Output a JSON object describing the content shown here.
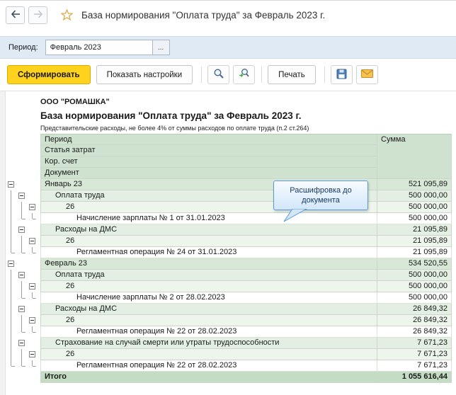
{
  "window": {
    "title": "База нормирования \"Оплата труда\" за Февраль 2023 г."
  },
  "period_bar": {
    "label": "Период:",
    "value": "Февраль 2023",
    "ellipsis": "..."
  },
  "toolbar": {
    "generate": "Сформировать",
    "settings": "Показать настройки",
    "print": "Печать"
  },
  "report": {
    "company": "ООО \"РОМАШКА\"",
    "title": "База нормирования \"Оплата труда\" за Февраль 2023 г.",
    "note": "Представительские расходы, не более 4% от суммы расходов по оплате труда (п.2 ст.264)",
    "header_rows": [
      "Период",
      "Статья затрат",
      "Кор. счет",
      "Документ"
    ],
    "sum_header": "Сумма",
    "rows": [
      {
        "label": "Январь 23",
        "value": "521 095,89",
        "level": 1,
        "expander": true
      },
      {
        "label": "Оплата труда",
        "value": "500 000,00",
        "level": 2,
        "expander": true
      },
      {
        "label": "26",
        "value": "500 000,00",
        "level": 3,
        "expander": true
      },
      {
        "label": "Начисление зарплаты № 1 от 31.01.2023",
        "value": "500 000,00",
        "level": 4,
        "expander": false
      },
      {
        "label": "Расходы на ДМС",
        "value": "21 095,89",
        "level": 2,
        "expander": true
      },
      {
        "label": "26",
        "value": "21 095,89",
        "level": 3,
        "expander": true
      },
      {
        "label": "Регламентная операция № 24 от 31.01.2023",
        "value": "21 095,89",
        "level": 4,
        "expander": false
      },
      {
        "label": "Февраль 23",
        "value": "534 520,55",
        "level": 1,
        "expander": true
      },
      {
        "label": "Оплата труда",
        "value": "500 000,00",
        "level": 2,
        "expander": true
      },
      {
        "label": "26",
        "value": "500 000,00",
        "level": 3,
        "expander": true
      },
      {
        "label": "Начисление зарплаты № 2 от 28.02.2023",
        "value": "500 000,00",
        "level": 4,
        "expander": false
      },
      {
        "label": "Расходы на ДМС",
        "value": "26 849,32",
        "level": 2,
        "expander": true
      },
      {
        "label": "26",
        "value": "26 849,32",
        "level": 3,
        "expander": true
      },
      {
        "label": "Регламентная операция № 22 от 28.02.2023",
        "value": "26 849,32",
        "level": 4,
        "expander": false
      },
      {
        "label": "Страхование на случай смерти или утраты трудоспособности",
        "value": "7 671,23",
        "level": 2,
        "expander": true
      },
      {
        "label": "26",
        "value": "7 671,23",
        "level": 3,
        "expander": true
      },
      {
        "label": "Регламентная операция № 22 от 28.02.2023",
        "value": "7 671,23",
        "level": 4,
        "expander": false
      }
    ],
    "total": {
      "label": "Итого",
      "value": "1 055 616,44"
    }
  },
  "callout": {
    "text": "Расшифровка до документа"
  },
  "colors": {
    "generate_button": "#ffd21e",
    "period_band": "#dfeaf5",
    "header_green": "#cfe2cf",
    "group1_green": "#d7e8d7",
    "group2_green": "#e2efe2",
    "group3_green": "#edf5ed",
    "total_green": "#c3dcc3",
    "callout_border": "#5b9bd5",
    "callout_fill": "#d3e7f9"
  }
}
